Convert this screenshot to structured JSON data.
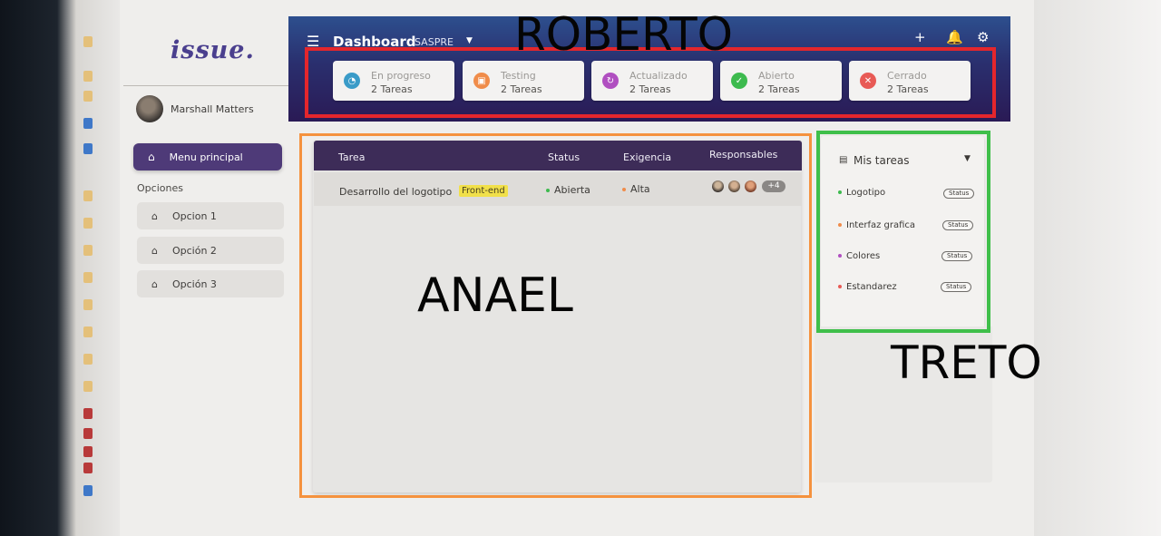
{
  "sidebar": {
    "logo": "issue.",
    "user_name": "Marshall Matters",
    "main_menu": "Menu principal",
    "options_heading": "Opciones",
    "options": [
      "Opcion 1",
      "Opción 2",
      "Opción 3"
    ]
  },
  "header": {
    "title": "Dashboard",
    "company": "SASPRE",
    "icons": [
      "menu-icon",
      "plus-icon",
      "bell-icon",
      "gear-icon"
    ],
    "cards": [
      {
        "label": "En progreso",
        "count": "2 Tareas",
        "color": "#3a9bc8"
      },
      {
        "label": "Testing",
        "count": "2 Tareas",
        "color": "#f08c4a"
      },
      {
        "label": "Actualizado",
        "count": "2 Tareas",
        "color": "#b04fc0"
      },
      {
        "label": "Abierto",
        "count": "2 Tareas",
        "color": "#3dba4e"
      },
      {
        "label": "Cerrado",
        "count": "2 Tareas",
        "color": "#e85a55"
      }
    ]
  },
  "table": {
    "headers": [
      "Tarea",
      "Status",
      "Exigencia",
      "Responsables"
    ],
    "rows": [
      {
        "task": "Desarrollo del logotipo",
        "tag": "Front-end",
        "status": "Abierta",
        "priority": "Alta",
        "more": "+4"
      }
    ]
  },
  "my_tasks": {
    "title": "Mis tareas",
    "items": [
      {
        "name": "Logotipo",
        "status": "Status",
        "color": "#3dba4e"
      },
      {
        "name": "Interfaz grafica",
        "status": "Status",
        "color": "#f08c4a"
      },
      {
        "name": "Colores",
        "status": "Status",
        "color": "#b04fc0"
      },
      {
        "name": "Estandarez",
        "status": "Status",
        "color": "#e85a55"
      }
    ]
  },
  "annotations": {
    "roberto": "ROBERTO",
    "anael": "ANAEL",
    "treto": "TRETO",
    "colors": {
      "roberto": "#e4262c",
      "anael": "#f5923e",
      "treto": "#3fbf4a"
    }
  }
}
